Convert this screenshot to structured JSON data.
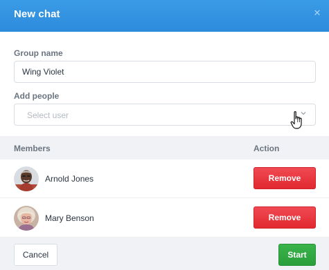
{
  "dialog": {
    "title": "New chat",
    "close_icon": "close-icon",
    "accent_color": "#3a9be6"
  },
  "form": {
    "group_name_label": "Group name",
    "group_name_value": "Wing Violet",
    "add_people_label": "Add people",
    "select_placeholder": "Select user"
  },
  "members": {
    "header_members": "Members",
    "header_action": "Action",
    "rows": [
      {
        "name": "Arnold Jones",
        "action": "Remove"
      },
      {
        "name": "Mary Benson",
        "action": "Remove"
      }
    ],
    "remove_color": "#e2282f"
  },
  "footer": {
    "cancel_label": "Cancel",
    "start_label": "Start",
    "start_color": "#2a9e3a"
  }
}
